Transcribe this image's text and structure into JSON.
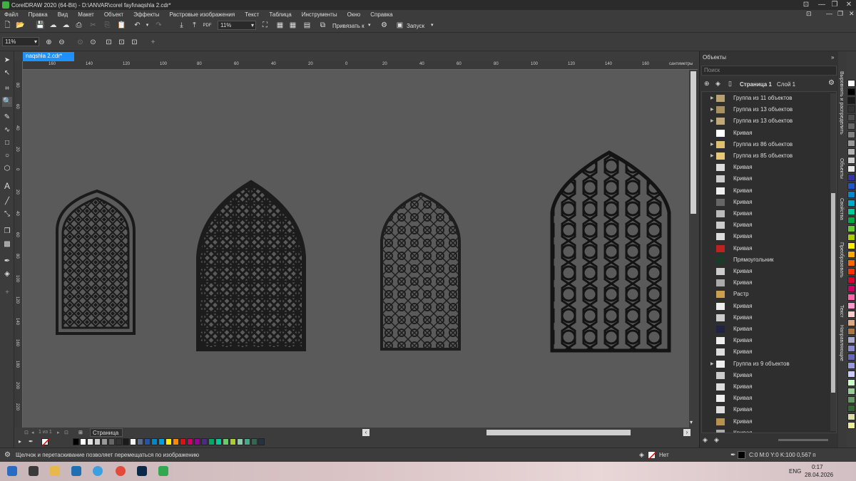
{
  "window": {
    "title": "CorelDRAW 2020 (64-Bit) - D:\\ANVAR\\corel fayl\\naqshla 2.cdr*"
  },
  "menu": [
    "Файл",
    "Правка",
    "Вид",
    "Макет",
    "Объект",
    "Эффекты",
    "Растровые изображения",
    "Текст",
    "Таблица",
    "Инструменты",
    "Окно",
    "Справка"
  ],
  "toolbar": {
    "zoom": "11%",
    "snap": "Привязать к",
    "launch": "Запуск",
    "pdf_label": "PDF"
  },
  "propbar": {
    "zoom": "11%"
  },
  "document": {
    "tab": "naqshla 2.cdr*"
  },
  "rulers": {
    "h_ticks": [
      "160",
      "140",
      "120",
      "100",
      "80",
      "60",
      "40",
      "20",
      "0",
      "20",
      "40",
      "60",
      "80",
      "100",
      "120",
      "140",
      "160"
    ],
    "units": "сантиметры",
    "v_ticks": [
      "80",
      "60",
      "40",
      "20",
      "0",
      "20",
      "40",
      "60",
      "80",
      "100",
      "120",
      "140",
      "160",
      "180",
      "200",
      "220"
    ]
  },
  "page_nav": {
    "counter": "1 из 1",
    "page_tab": "Страница 1"
  },
  "status": {
    "hint": "Щелчок и перетаскивание позволяет перемещаться по изображению",
    "fill": "Нет",
    "outline": "C:0 M:0 Y:0 K:100  0,567 п"
  },
  "docker": {
    "title": "Объекты",
    "search_placeholder": "Поиск",
    "page": "Страница 1",
    "layer": "Слой 1",
    "rows": [
      {
        "label": "Группа из 11 объектов",
        "thumb": "#b8a070",
        "group": true
      },
      {
        "label": "Группа из 13 объектов",
        "thumb": "#a89060",
        "group": true
      },
      {
        "label": "Группа из 13 объектов",
        "thumb": "#c0a878",
        "group": true
      },
      {
        "label": "Кривая",
        "thumb": "#ffffff",
        "group": false
      },
      {
        "label": "Группа из 86 объектов",
        "thumb": "#e0c070",
        "group": true
      },
      {
        "label": "Группа из 85 объектов",
        "thumb": "#e8c878",
        "group": true
      },
      {
        "label": "Кривая",
        "thumb": "#ddd",
        "group": false
      },
      {
        "label": "Кривая",
        "thumb": "#ccc",
        "group": false
      },
      {
        "label": "Кривая",
        "thumb": "#eee",
        "group": false
      },
      {
        "label": "Кривая",
        "thumb": "#666",
        "group": false
      },
      {
        "label": "Кривая",
        "thumb": "#bbb",
        "group": false
      },
      {
        "label": "Кривая",
        "thumb": "#ccc",
        "group": false
      },
      {
        "label": "Кривая",
        "thumb": "#ddd",
        "group": false
      },
      {
        "label": "Кривая",
        "thumb": "#b22",
        "group": false
      },
      {
        "label": "Прямоугольник",
        "thumb": "#1a3a2a",
        "group": false
      },
      {
        "label": "Кривая",
        "thumb": "#ccc",
        "group": false
      },
      {
        "label": "Кривая",
        "thumb": "#aaa",
        "group": false
      },
      {
        "label": "Растр",
        "thumb": "#c8a050",
        "group": false
      },
      {
        "label": "Кривая",
        "thumb": "#eee",
        "group": false
      },
      {
        "label": "Кривая",
        "thumb": "#ccc",
        "group": false
      },
      {
        "label": "Кривая",
        "thumb": "#224",
        "group": false
      },
      {
        "label": "Кривая",
        "thumb": "#eee",
        "group": false
      },
      {
        "label": "Кривая",
        "thumb": "#ddd",
        "group": false
      },
      {
        "label": "Группа из 9 объектов",
        "thumb": "#eee",
        "group": true
      },
      {
        "label": "Кривая",
        "thumb": "#ccc",
        "group": false
      },
      {
        "label": "Кривая",
        "thumb": "#ddd",
        "group": false
      },
      {
        "label": "Кривая",
        "thumb": "#eee",
        "group": false
      },
      {
        "label": "Кривая",
        "thumb": "#ddd",
        "group": false
      },
      {
        "label": "Кривая",
        "thumb": "#b89050",
        "group": false
      },
      {
        "label": "Кривая",
        "thumb": "#aaa",
        "group": false
      }
    ]
  },
  "side_tabs": [
    "Выровнять и распределить",
    "Объекты",
    "Свойства",
    "Преобразовать",
    "Текст",
    "Направляющие"
  ],
  "palette": [
    "#000000",
    "#ffffff",
    "#e6e6e6",
    "#cccccc",
    "#999999",
    "#666666",
    "#333333",
    "#1a1a1a",
    "#f5f5f5",
    "#5a6b8c",
    "#2255aa",
    "#0088cc",
    "#00a0e0",
    "#ffee00",
    "#ff8800",
    "#dd1111",
    "#cc0066",
    "#990099",
    "#4b2a8a",
    "#00aa66",
    "#00cc99",
    "#66cc66",
    "#aacc33",
    "#88ccaa",
    "#44aa88",
    "#336655",
    "#223344"
  ],
  "rpalette": [
    "#ffffff",
    "#000000",
    "#1a1a1a",
    "#333333",
    "#4d4d4d",
    "#666666",
    "#808080",
    "#999999",
    "#b3b3b3",
    "#cccccc",
    "#e6e6e6",
    "#3333aa",
    "#2255cc",
    "#0088cc",
    "#00aacc",
    "#00cc99",
    "#00aa44",
    "#66cc33",
    "#aacc00",
    "#ffee00",
    "#ffaa00",
    "#ff6600",
    "#ff3300",
    "#dd0033",
    "#cc0066",
    "#ff66aa",
    "#ff99cc",
    "#ffcccc",
    "#ddaa88",
    "#aa7744",
    "#aaaacc",
    "#8888cc",
    "#6666bb",
    "#9999dd",
    "#ccccff",
    "#ccffcc",
    "#99cc99",
    "#669966",
    "#336633",
    "#ddddaa",
    "#eeee99"
  ],
  "clock": {
    "time": "0:17",
    "date": "28.04.2026",
    "lang": "ENG"
  }
}
